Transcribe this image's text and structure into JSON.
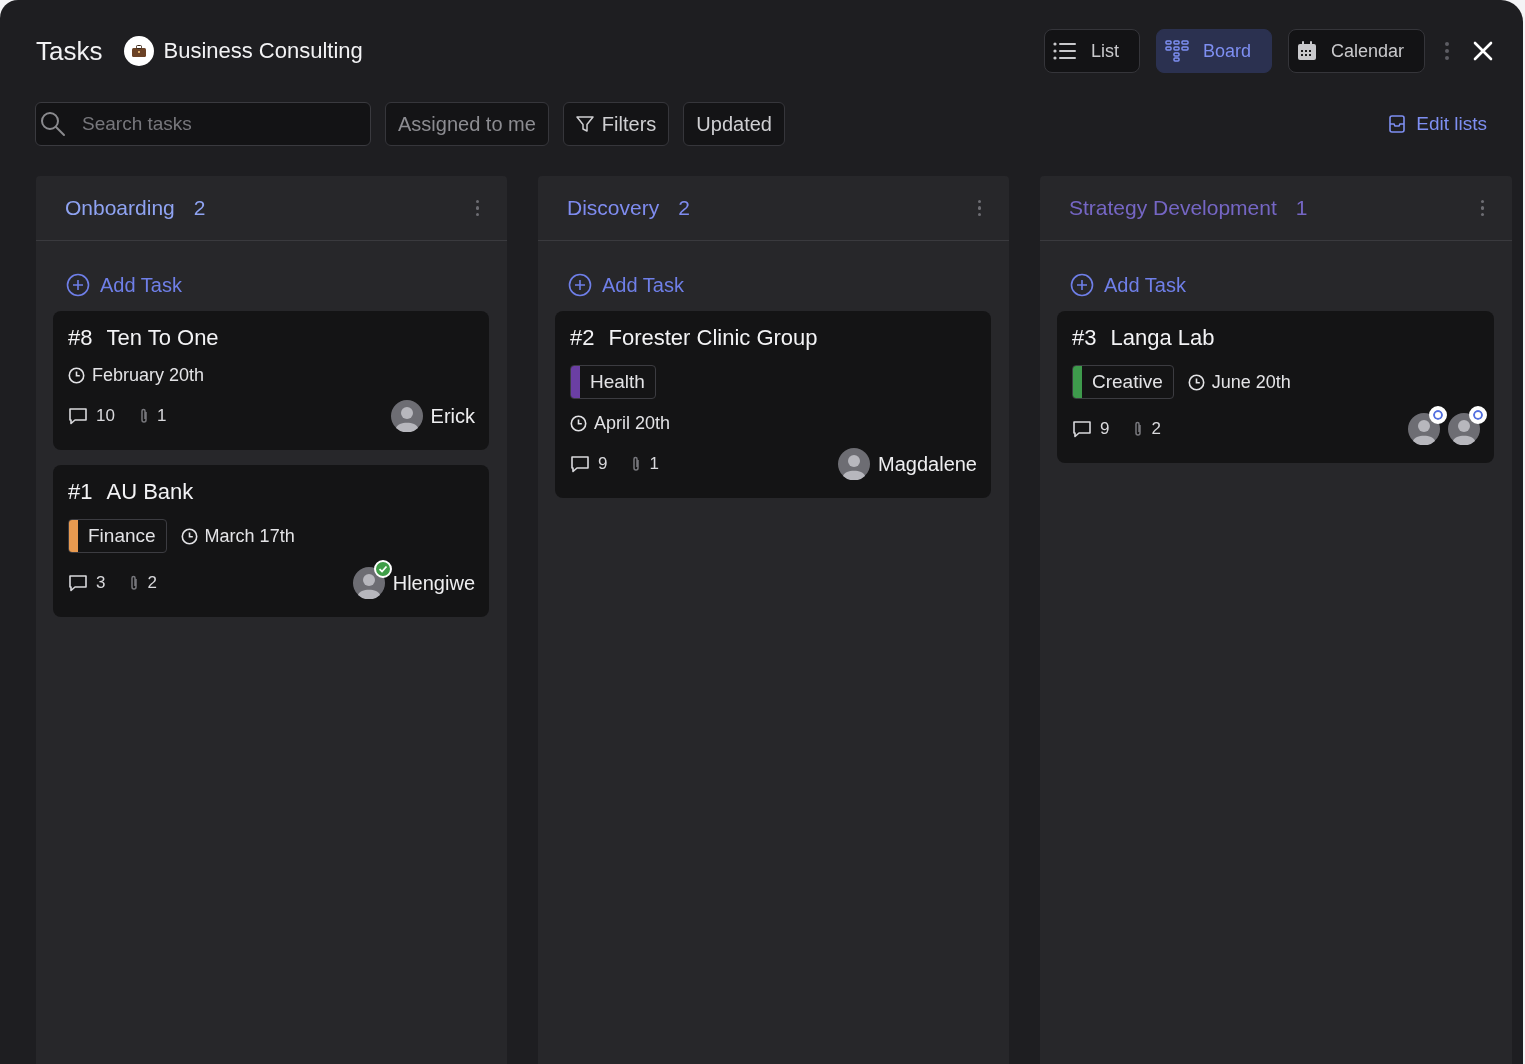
{
  "header": {
    "title": "Tasks",
    "project": "Business Consulting"
  },
  "views": [
    {
      "label": "List",
      "selected": false
    },
    {
      "label": "Board",
      "selected": true
    },
    {
      "label": "Calendar",
      "selected": false
    }
  ],
  "toolbar": {
    "search": {
      "placeholder": "Search tasks"
    },
    "assigned": "Assigned to me",
    "filters": "Filters",
    "sort": "Updated",
    "edit_lists": "Edit lists"
  },
  "columns": [
    {
      "title": "Onboarding",
      "count": "2",
      "color": "#8fa3f2",
      "add_label": "Add Task",
      "cards": [
        {
          "number": "#8",
          "title": "Ten To One",
          "date": "February 20th",
          "comments": "10",
          "attachments": "1",
          "assignees": [
            {
              "name": "Erick",
              "kind": "plain"
            }
          ]
        },
        {
          "number": "#1",
          "title": "AU Bank",
          "tag": {
            "label": "Finance",
            "color": "#e89a50"
          },
          "date": "March 17th",
          "date_inline": true,
          "comments": "3",
          "attachments": "2",
          "assignees": [
            {
              "name": "Hlengiwe",
              "kind": "done"
            }
          ]
        }
      ]
    },
    {
      "title": "Discovery",
      "count": "2",
      "color": "#7f8cf0",
      "add_label": "Add Task",
      "cards": [
        {
          "number": "#2",
          "title": "Forester Clinic Group",
          "tag": {
            "label": "Health",
            "color": "#6b3fa3"
          },
          "date": "April 20th",
          "date_inline": false,
          "comments": "9",
          "attachments": "1",
          "assignees": [
            {
              "name": "Magdalene",
              "kind": "plain"
            }
          ]
        }
      ]
    },
    {
      "title": "Strategy Development",
      "count": "1",
      "color": "#7566c4",
      "add_label": "Add Task",
      "cards": [
        {
          "number": "#3",
          "title": "Langa Lab",
          "tag": {
            "label": "Creative",
            "color": "#3e9a4c"
          },
          "date": "June 20th",
          "date_inline": true,
          "comments": "9",
          "attachments": "2",
          "assignees": [
            {
              "kind": "progress"
            },
            {
              "kind": "progress"
            }
          ]
        }
      ]
    }
  ]
}
